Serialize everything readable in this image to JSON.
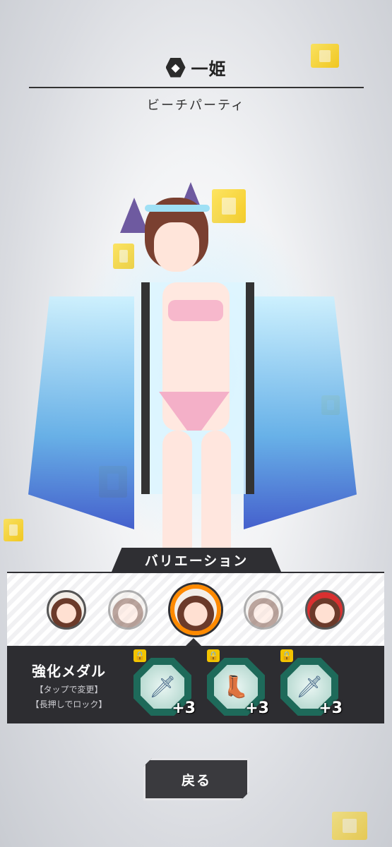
{
  "header": {
    "faction_icon": "faction-emblem-icon",
    "character_name": "一姫",
    "outfit_name": "ビーチパーティ"
  },
  "variation": {
    "title": "バリエーション",
    "items": [
      {
        "state": "normal",
        "theme": "default"
      },
      {
        "state": "dim",
        "theme": "default"
      },
      {
        "state": "selected",
        "theme": "beach"
      },
      {
        "state": "dim",
        "theme": "default"
      },
      {
        "state": "normal",
        "theme": "red"
      }
    ]
  },
  "medals": {
    "title": "強化メダル",
    "hint_tap": "【タップで変更】",
    "hint_hold": "【長押しでロック】",
    "slots": [
      {
        "icon": "sword-icon",
        "level": "+3"
      },
      {
        "icon": "boot-icon",
        "level": "+3"
      },
      {
        "icon": "sword-icon",
        "level": "+3"
      }
    ]
  },
  "back_button": {
    "label": "戻る"
  },
  "colors": {
    "accent": "#ff8a00",
    "panel": "#2d2d31",
    "medal_frame": "#1e6a5a",
    "lock": "#f3c400"
  }
}
